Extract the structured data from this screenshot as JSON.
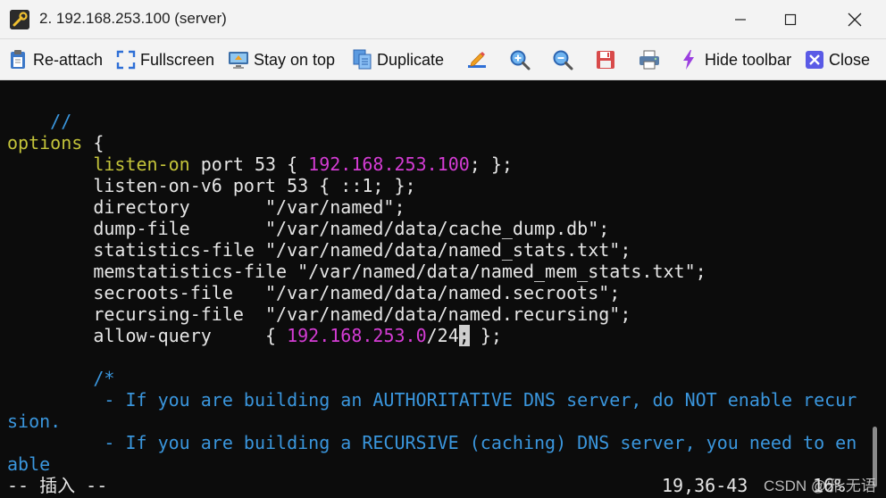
{
  "window": {
    "title": "2. 192.168.253.100 (server)"
  },
  "toolbar": {
    "reattach": "Re-attach",
    "fullscreen": "Fullscreen",
    "stay_on_top": "Stay on top",
    "duplicate": "Duplicate",
    "hide_toolbar": "Hide toolbar",
    "close": "Close"
  },
  "terminal": {
    "l1": "//",
    "l3_key": "options",
    "l3_rest": " {",
    "l4_ind": "        ",
    "l4_key": "listen-on",
    "l4_a": " port 53 { ",
    "l4_ip": "192.168.253.100",
    "l4_b": "; };",
    "l5": "        listen-on-v6 port 53 { ::1; };",
    "l6": "        directory       \"/var/named\";",
    "l7": "        dump-file       \"/var/named/data/cache_dump.db\";",
    "l8": "        statistics-file \"/var/named/data/named_stats.txt\";",
    "l9": "        memstatistics-file \"/var/named/data/named_mem_stats.txt\";",
    "l10": "        secroots-file   \"/var/named/data/named.secroots\";",
    "l11": "        recursing-file  \"/var/named/data/named.recursing\";",
    "l12_a": "        allow-query     { ",
    "l12_ip": "192.168.253.0",
    "l12_b": "/24",
    "l12_cursor": ";",
    "l12_c": " };",
    "l14": "        /*",
    "l15": "         - If you are building an AUTHORITATIVE DNS server, do NOT enable recur",
    "l16": "sion.",
    "l17": "         - If you are building a RECURSIVE (caching) DNS server, you need to en",
    "l18": "able",
    "status_mode": "-- 插入 --",
    "status_pos": "19,36-43",
    "status_pct": "16%"
  },
  "watermark": "CSDN @邪.无语",
  "colors": {
    "comment": "#3a96dd",
    "keyword": "#c4c43a",
    "ip": "#d43cd4",
    "text": "#e6e6e6",
    "background": "#0c0c0c"
  },
  "icons": {
    "app": "wrench-icon",
    "reattach": "clipboard-icon",
    "fullscreen": "fullscreen-arrows-icon",
    "stay_on_top": "monitor-icon",
    "duplicate": "duplicate-icon",
    "edit": "pencil-icon",
    "zoom_in": "zoom-in-icon",
    "zoom_out": "zoom-out-icon",
    "save": "save-icon",
    "print": "printer-icon",
    "hide_toolbar": "lightning-icon",
    "close": "close-x-icon"
  }
}
